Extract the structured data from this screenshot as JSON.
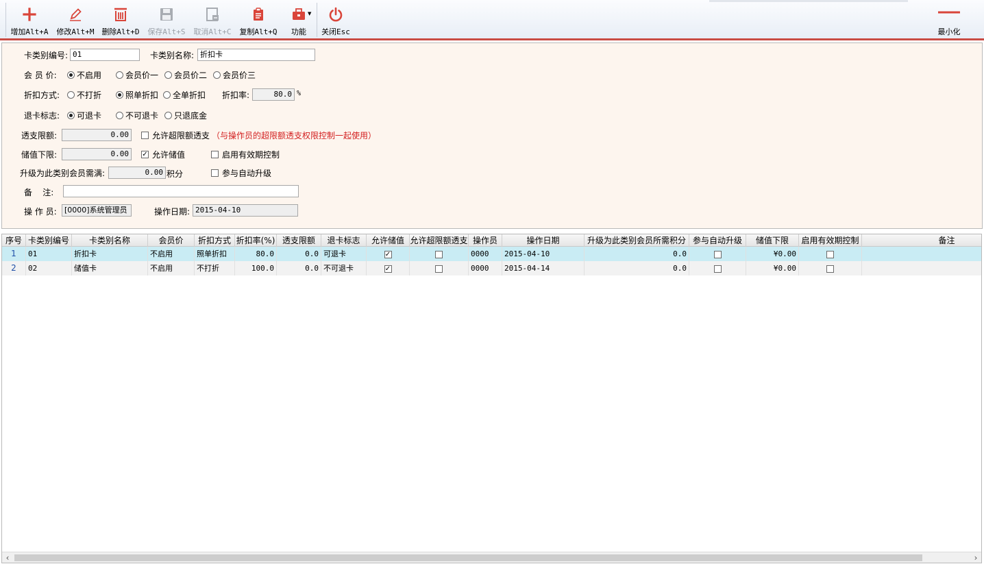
{
  "toolbar": {
    "add": "增加Alt+A",
    "edit": "修改Alt+M",
    "delete": "删除Alt+D",
    "save": "保存Alt+S",
    "cancel": "取消Alt+C",
    "copy": "复制Alt+Q",
    "function": "功能",
    "close": "关闭Esc",
    "minimize": "最小化"
  },
  "form": {
    "card_code_label": "卡类别编号:",
    "card_code_value": "01",
    "card_name_label": "卡类别名称:",
    "card_name_value": "折扣卡",
    "member_price_label": "会 员 价:",
    "member_price_options": [
      "不启用",
      "会员价一",
      "会员价二",
      "会员价三"
    ],
    "member_price_selected": 0,
    "discount_mode_label": "折扣方式:",
    "discount_mode_options": [
      "不打折",
      "照单折扣",
      "全单折扣"
    ],
    "discount_mode_selected": 1,
    "discount_rate_label": "折扣率:",
    "discount_rate_value": "80.0",
    "discount_rate_unit": "%",
    "refund_label": "退卡标志:",
    "refund_options": [
      "可退卡",
      "不可退卡",
      "只退底金"
    ],
    "refund_selected": 0,
    "overdraft_label": "透支限额:",
    "overdraft_value": "0.00",
    "allow_over_label": "允许超限额透支",
    "allow_over_checked": false,
    "allow_over_note": "（与操作员的超限额透支权限控制一起使用）",
    "min_store_label": "储值下限:",
    "min_store_value": "0.00",
    "allow_store_label": "允许储值",
    "allow_store_checked": true,
    "validity_label": "启用有效期控制",
    "validity_checked": false,
    "upgrade_label": "升级为此类别会员需满:",
    "upgrade_value": "0.00",
    "upgrade_unit": "积分",
    "auto_upgrade_label": "参与自动升级",
    "auto_upgrade_checked": false,
    "remark_label": "备    注:",
    "remark_value": "",
    "operator_label": "操 作 员:",
    "operator_value": "[0000]系统管理员",
    "op_date_label": "操作日期:",
    "op_date_value": "2015-04-10"
  },
  "grid": {
    "columns": [
      "序号",
      "卡类别编号",
      "卡类别名称",
      "会员价",
      "折扣方式",
      "折扣率(%)",
      "透支限额",
      "退卡标志",
      "允许储值",
      "允许超限额透支",
      "操作员",
      "操作日期",
      "升级为此类别会员所需积分",
      "参与自动升级",
      "储值下限",
      "启用有效期控制",
      "备注"
    ],
    "rows": [
      {
        "seq": "1",
        "code": "01",
        "name": "折扣卡",
        "member_price": "不启用",
        "mode": "照单折扣",
        "rate": "80.0",
        "overdraft": "0.0",
        "refund": "可退卡",
        "allow_store": true,
        "allow_over": false,
        "operator": "0000",
        "date": "2015-04-10",
        "points": "0.0",
        "auto_upgrade": false,
        "min_store": "¥0.00",
        "validity": false,
        "remark": ""
      },
      {
        "seq": "2",
        "code": "02",
        "name": "储值卡",
        "member_price": "不启用",
        "mode": "不打折",
        "rate": "100.0",
        "overdraft": "0.0",
        "refund": "不可退卡",
        "allow_store": true,
        "allow_over": false,
        "operator": "0000",
        "date": "2015-04-14",
        "points": "0.0",
        "auto_upgrade": false,
        "min_store": "¥0.00",
        "validity": false,
        "remark": ""
      }
    ]
  },
  "colors": {
    "accent": "#d9453a",
    "selected_row": "#c9ecf4",
    "form_bg": "#fdf5ee",
    "warning": "#d32020"
  },
  "icons": [
    "plus-icon",
    "pencil-icon",
    "trash-icon",
    "floppy-icon",
    "cancel-doc-icon",
    "clipboard-icon",
    "toolbox-icon",
    "power-icon",
    "minimize-icon"
  ]
}
